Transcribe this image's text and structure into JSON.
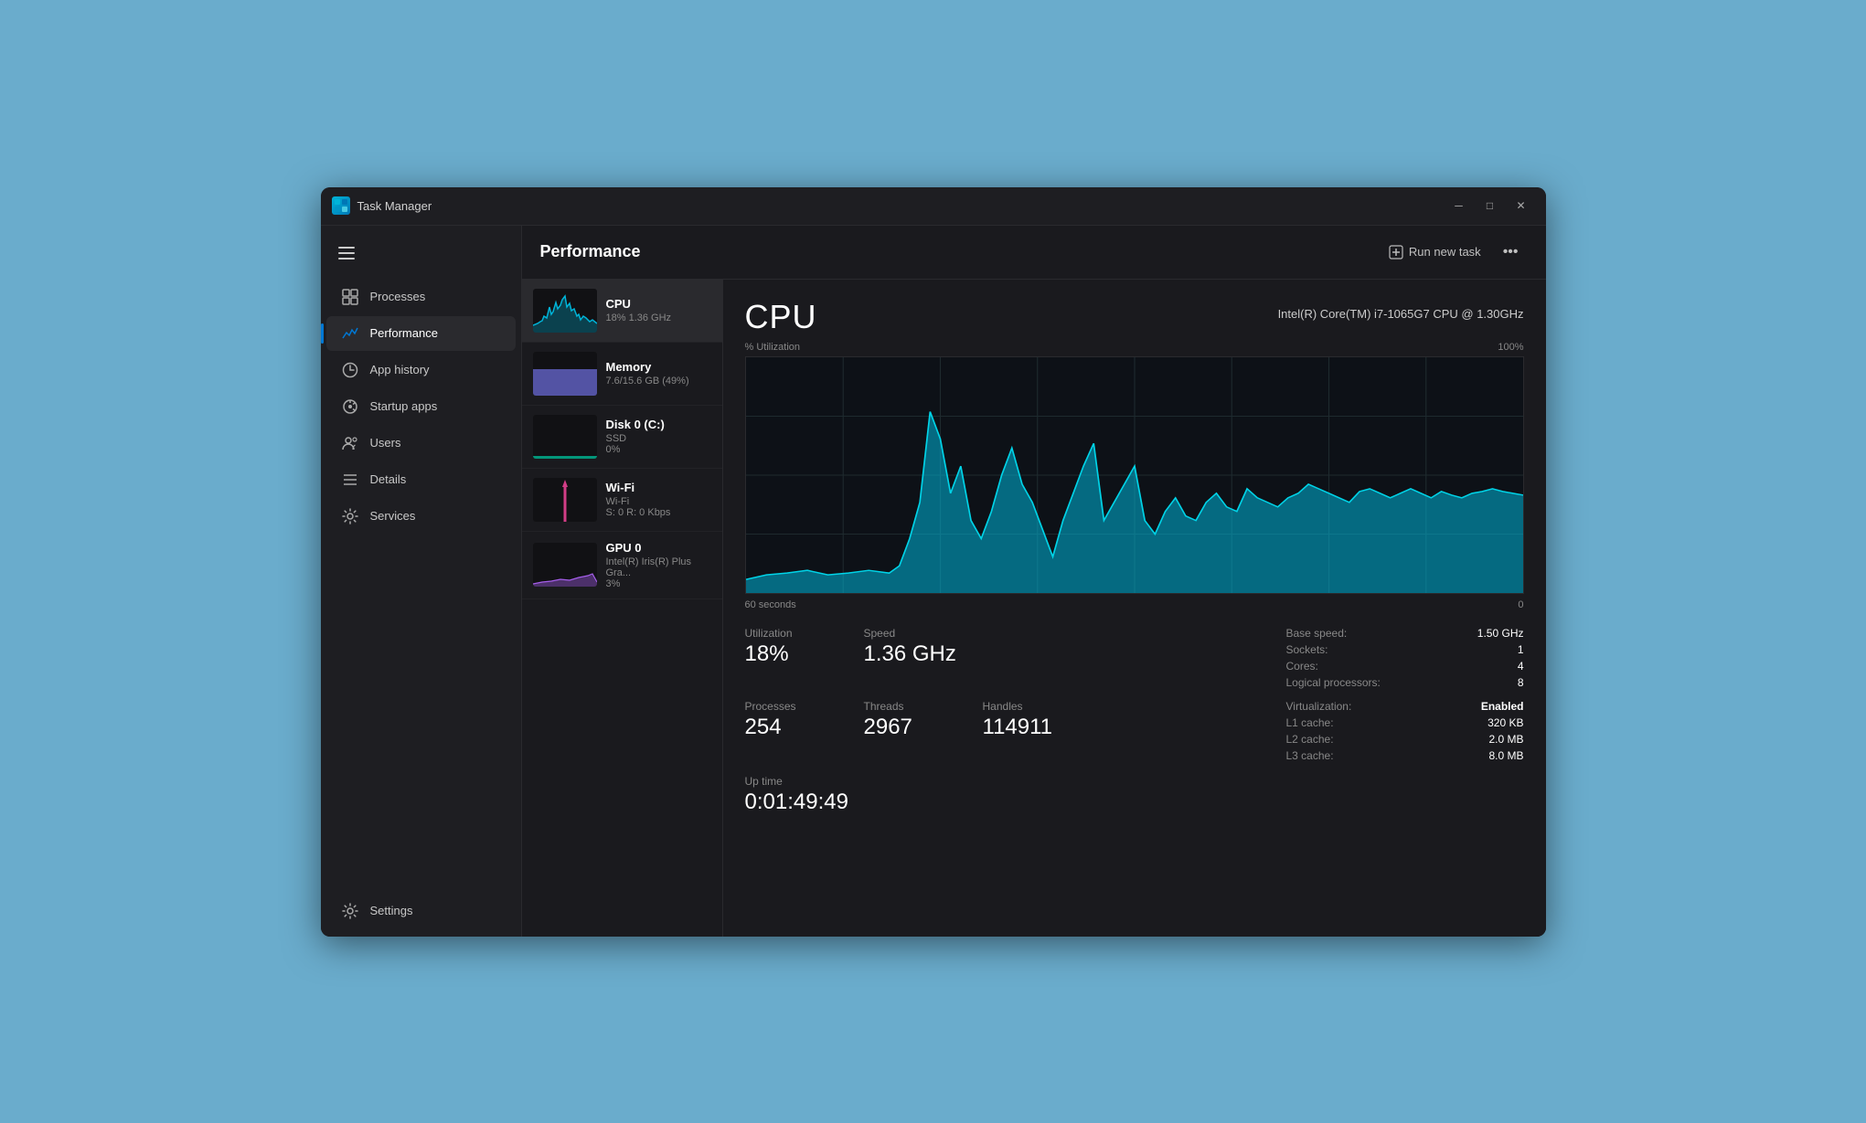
{
  "window": {
    "title": "Task Manager",
    "icon": "TM"
  },
  "titlebar": {
    "title": "Task Manager",
    "minimize": "─",
    "maximize": "□",
    "close": "✕"
  },
  "sidebar": {
    "hamburger_label": "☰",
    "items": [
      {
        "id": "processes",
        "label": "Processes",
        "icon": "⊞",
        "active": false
      },
      {
        "id": "performance",
        "label": "Performance",
        "icon": "📈",
        "active": true
      },
      {
        "id": "app-history",
        "label": "App history",
        "icon": "🕐",
        "active": false
      },
      {
        "id": "startup-apps",
        "label": "Startup apps",
        "icon": "⚙",
        "active": false
      },
      {
        "id": "users",
        "label": "Users",
        "icon": "👤",
        "active": false
      },
      {
        "id": "details",
        "label": "Details",
        "icon": "≡",
        "active": false
      },
      {
        "id": "services",
        "label": "Services",
        "icon": "⚙",
        "active": false
      }
    ],
    "settings_label": "Settings",
    "settings_icon": "⚙"
  },
  "main": {
    "header": {
      "title": "Performance",
      "run_new_task_label": "Run new task",
      "more_label": "•••"
    },
    "perf_items": [
      {
        "id": "cpu",
        "name": "CPU",
        "sub1": "18%  1.36 GHz",
        "type": "cpu",
        "active": true
      },
      {
        "id": "memory",
        "name": "Memory",
        "sub1": "7.6/15.6 GB (49%)",
        "type": "memory",
        "active": false
      },
      {
        "id": "disk",
        "name": "Disk 0 (C:)",
        "sub1": "SSD",
        "sub2": "0%",
        "type": "disk",
        "active": false
      },
      {
        "id": "wifi",
        "name": "Wi-Fi",
        "sub1": "Wi-Fi",
        "sub2": "S: 0  R: 0 Kbps",
        "type": "wifi",
        "active": false
      },
      {
        "id": "gpu",
        "name": "GPU 0",
        "sub1": "Intel(R) Iris(R) Plus Gra...",
        "sub2": "3%",
        "type": "gpu",
        "active": false
      }
    ],
    "cpu_detail": {
      "label": "CPU",
      "model": "Intel(R) Core(TM) i7-1065G7 CPU @ 1.30GHz",
      "util_label": "% Utilization",
      "chart_max": "100%",
      "chart_time_left": "60 seconds",
      "chart_time_right": "0",
      "utilization_label": "Utilization",
      "utilization_value": "18%",
      "speed_label": "Speed",
      "speed_value": "1.36 GHz",
      "processes_label": "Processes",
      "processes_value": "254",
      "threads_label": "Threads",
      "threads_value": "2967",
      "handles_label": "Handles",
      "handles_value": "114911",
      "uptime_label": "Up time",
      "uptime_value": "0:01:49:49",
      "specs": [
        {
          "key": "Base speed:",
          "value": "1.50 GHz"
        },
        {
          "key": "Sockets:",
          "value": "1"
        },
        {
          "key": "Cores:",
          "value": "4"
        },
        {
          "key": "Logical processors:",
          "value": "8"
        },
        {
          "key": "Virtualization:",
          "value": "Enabled",
          "highlight": true
        },
        {
          "key": "L1 cache:",
          "value": "320 KB"
        },
        {
          "key": "L2 cache:",
          "value": "2.0 MB"
        },
        {
          "key": "L3 cache:",
          "value": "8.0 MB"
        }
      ]
    }
  }
}
